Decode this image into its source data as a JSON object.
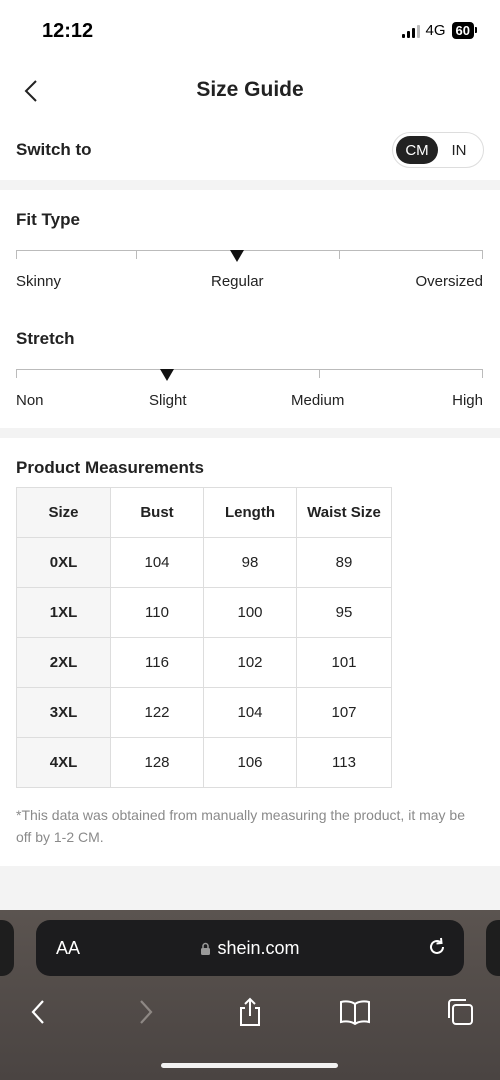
{
  "status_bar": {
    "time": "12:12",
    "network": "4G",
    "battery": "60"
  },
  "nav": {
    "title": "Size Guide"
  },
  "unit_switch": {
    "label": "Switch to",
    "options": [
      "CM",
      "IN"
    ],
    "selected": "CM"
  },
  "fit_type": {
    "title": "Fit Type",
    "labels": [
      "Skinny",
      "Regular",
      "Oversized"
    ],
    "selected": "Regular"
  },
  "stretch": {
    "title": "Stretch",
    "labels": [
      "Non",
      "Slight",
      "Medium",
      "High"
    ],
    "selected": "Slight"
  },
  "measurements": {
    "title": "Product Measurements",
    "headers": [
      "Size",
      "Bust",
      "Length",
      "Waist Size"
    ],
    "rows": [
      [
        "0XL",
        "104",
        "98",
        "89"
      ],
      [
        "1XL",
        "110",
        "100",
        "95"
      ],
      [
        "2XL",
        "116",
        "102",
        "101"
      ],
      [
        "3XL",
        "122",
        "104",
        "107"
      ],
      [
        "4XL",
        "128",
        "106",
        "113"
      ]
    ],
    "note": "*This data was obtained from manually measuring the product, it may be off by 1-2 CM."
  },
  "browser": {
    "text_size_label": "AA",
    "url": "shein.com"
  }
}
